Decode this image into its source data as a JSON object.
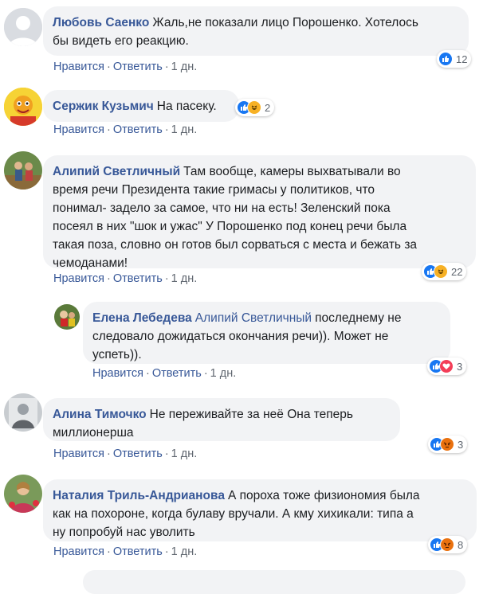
{
  "colors": {
    "author": "#385898",
    "bubble": "#f2f3f5",
    "action": "#385898",
    "meta": "#606770",
    "like": "#1877f2",
    "haha": "#f7b125",
    "angry": "#e9710f",
    "love": "#f33e58"
  },
  "actions": {
    "like": "Нравится",
    "reply": "Ответить",
    "sep": "·"
  },
  "comments": [
    {
      "author": "Любовь Саенко",
      "line1": "Жаль,не показали лицо Порошенко. Хотелось",
      "line2": "бы видеть его реакцию.",
      "time": "1 дн.",
      "reactions": [
        "like-icon"
      ],
      "count": "12"
    },
    {
      "author": "Сержик Кузьмич",
      "line1": "На пасеку.",
      "time": "1 дн.",
      "reactions": [
        "like-icon",
        "haha-icon"
      ],
      "count": "2"
    },
    {
      "author": "Алипий Светличный",
      "line1": "Там вообще, камеры выхватывали во",
      "line2": "время речи Президента такие гримасы у политиков, что",
      "line3": "понимал- задело за самое, что ни на есть! Зеленский пока",
      "line4": "посеял в них \"шок и ужас\" У Порошенко под конец речи была",
      "line5": "такая поза, словно он готов был сорваться с места и бежать за",
      "line6": "чемоданами!",
      "time": "1 дн.",
      "reactions": [
        "like-icon",
        "haha-icon"
      ],
      "count": "22"
    },
    {
      "author": "Елена Лебедева",
      "reply_to": "Алипий Светличный",
      "line1": "последнему не",
      "line2": "следовало дожидаться окончания речи)). Может не",
      "line3": "успеть)).",
      "time": "1 дн.",
      "reactions": [
        "like-icon",
        "love-icon"
      ],
      "count": "3"
    },
    {
      "author": "Алина Тимочко",
      "line1": "Не переживайте за неё Она теперь",
      "line2": "миллионерша",
      "time": "1 дн.",
      "reactions": [
        "like-icon",
        "angry-icon"
      ],
      "count": "3"
    },
    {
      "author": "Наталия Триль-Андрианова",
      "line1": "А пороха тоже физиономия была",
      "line2": "как на похороне, когда булаву вручали. А кму хихикали: типа а",
      "line3": "ну попробуй нас уволить",
      "time": "1 дн.",
      "reactions": [
        "like-icon",
        "angry-icon"
      ],
      "count": "8"
    }
  ]
}
